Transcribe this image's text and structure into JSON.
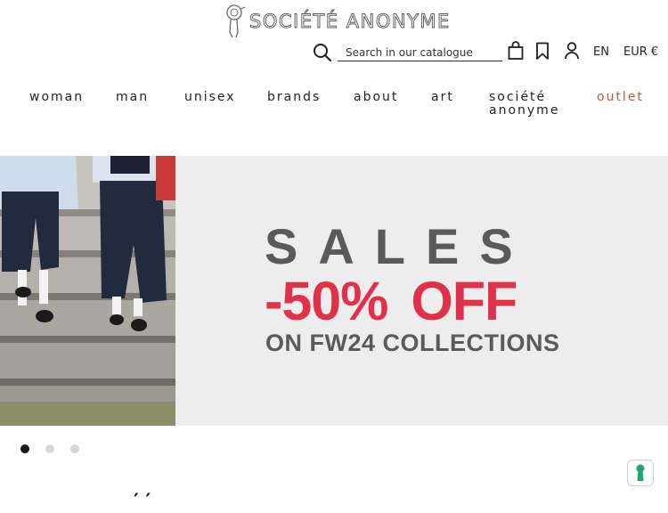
{
  "header": {
    "logo_text": "SOCIÉTÉ ANONYME",
    "search": {
      "placeholder": "Search in our catalogue",
      "value": ""
    },
    "language": "EN",
    "currency": "EUR €",
    "icons": [
      "search-icon",
      "cart-icon",
      "bookmark-icon",
      "account-icon"
    ]
  },
  "nav": {
    "items": [
      {
        "label": "woman"
      },
      {
        "label": "man"
      },
      {
        "label": "unisex"
      },
      {
        "label": "brands"
      },
      {
        "label": "about"
      },
      {
        "label": "art"
      },
      {
        "label": "société anonyme"
      },
      {
        "label": "outlet"
      }
    ]
  },
  "banner": {
    "headline": "SALES",
    "offer": "-50% OFF",
    "subline": "ON FW24 COLLECTIONS",
    "colors": {
      "headline": "#5a5a5c",
      "offer": "#e0314a"
    }
  },
  "carousel": {
    "slide_count": 3,
    "active_index": 0
  },
  "bottom": {
    "heading_fragment": "′ ′"
  },
  "colors": {
    "outlet": "#c05a3c",
    "privacy_accent": "#1ca86b"
  }
}
